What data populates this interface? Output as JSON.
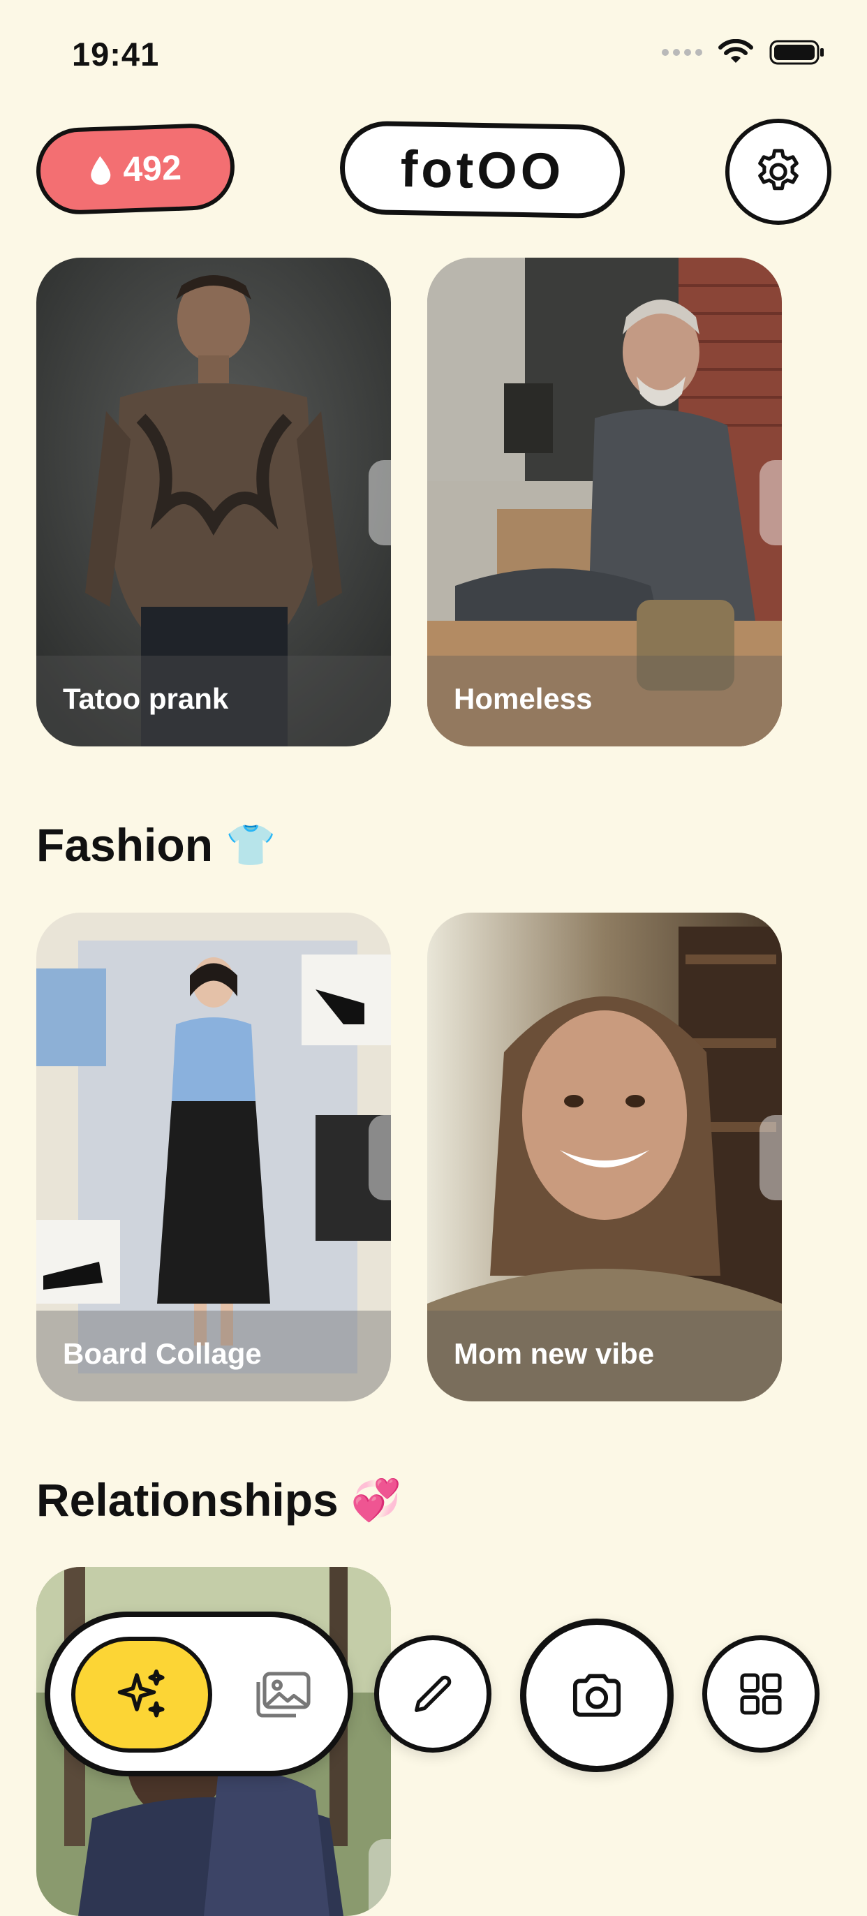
{
  "status_bar": {
    "time": "19:41"
  },
  "header": {
    "credits": "492",
    "logo": "fotOO",
    "settings_icon": "gear-icon"
  },
  "cards_row1": [
    {
      "label": "Tatoo prank"
    },
    {
      "label": "Homeless"
    }
  ],
  "fashion": {
    "title": "Fashion",
    "emoji": "👕",
    "cards": [
      {
        "label": "Board Collage"
      },
      {
        "label": "Mom new vibe"
      }
    ]
  },
  "relationships": {
    "title": "Relationships",
    "emoji": "💞"
  },
  "bottom_bar": {
    "generate_icon": "sparkles-icon",
    "gallery_icon": "image-icon",
    "edit_icon": "pencil-icon",
    "camera_icon": "camera-icon",
    "grid_icon": "grid-icon"
  },
  "colors": {
    "background": "#FCF8E6",
    "credits_pill": "#F36F72",
    "generate_active": "#FCD535"
  }
}
